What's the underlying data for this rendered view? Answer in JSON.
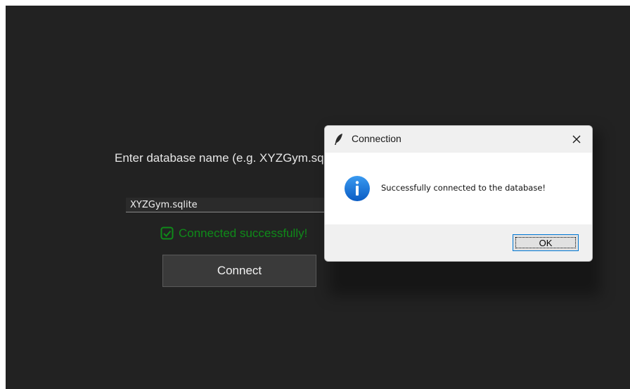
{
  "app": {
    "prompt": "Enter database name (e.g. XYZGym.sqlite):",
    "db_input_value": "XYZGym.sqlite",
    "status_message": "Connected successfully!",
    "connect_label": "Connect",
    "colors": {
      "background": "#222222",
      "status": "#0f8a19"
    }
  },
  "dialog": {
    "title": "Connection",
    "message": "Successfully connected to the database!",
    "ok_label": "OK",
    "icons": {
      "title": "feather-icon",
      "close": "close-icon",
      "message": "info-icon"
    }
  }
}
